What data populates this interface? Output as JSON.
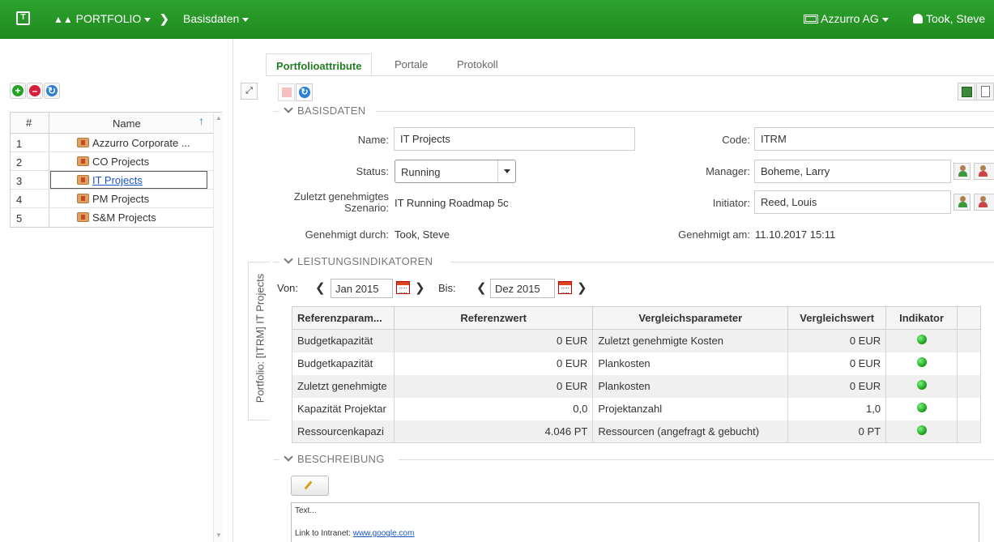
{
  "topbar": {
    "logo": "T",
    "portfolio_menu": "PORTFOLIO",
    "breadcrumb": "Basisdaten",
    "company": "Azzurro AG",
    "user": "Took, Steve"
  },
  "left": {
    "col_num": "#",
    "col_name": "Name",
    "rows": [
      {
        "num": "1",
        "name": "Azzurro Corporate ..."
      },
      {
        "num": "2",
        "name": "CO Projects"
      },
      {
        "num": "3",
        "name": "IT Projects"
      },
      {
        "num": "4",
        "name": "PM Projects"
      },
      {
        "num": "5",
        "name": "S&M Projects"
      }
    ]
  },
  "tabs": {
    "attr": "Portfolioattribute",
    "portale": "Portale",
    "protokoll": "Protokoll"
  },
  "vertical_tab": "Portfolio: [ITRM] IT Projects",
  "basisdaten": {
    "header": "BASISDATEN",
    "name_label": "Name:",
    "name_value": "IT Projects",
    "status_label": "Status:",
    "status_value": "Running",
    "scenario_label_1": "Zuletzt genehmigtes",
    "scenario_label_2": "Szenario:",
    "scenario_value": "IT Running Roadmap 5c",
    "approved_by_label": "Genehmigt durch:",
    "approved_by_value": "Took, Steve",
    "code_label": "Code:",
    "code_value": "ITRM",
    "manager_label": "Manager:",
    "manager_value": "Boheme, Larry",
    "initiator_label": "Initiator:",
    "initiator_value": "Reed, Louis",
    "approved_at_label": "Genehmigt am:",
    "approved_at_value": "11.10.2017 15:11"
  },
  "kpi": {
    "header": "LEISTUNGSINDIKATOREN",
    "von_label": "Von:",
    "von_value": "Jan 2015",
    "bis_label": "Bis:",
    "bis_value": "Dez 2015",
    "columns": [
      "Referenzparam...",
      "Referenzwert",
      "Vergleichsparameter",
      "Vergleichswert",
      "Indikator"
    ],
    "rows": [
      {
        "ref": "Budgetkapazität",
        "refval": "0 EUR",
        "cmp": "Zuletzt genehmigte Kosten",
        "cmpval": "0 EUR"
      },
      {
        "ref": "Budgetkapazität",
        "refval": "0 EUR",
        "cmp": "Plankosten",
        "cmpval": "0 EUR"
      },
      {
        "ref": "Zuletzt genehmigte",
        "refval": "0 EUR",
        "cmp": "Plankosten",
        "cmpval": "0 EUR"
      },
      {
        "ref": "Kapazität Projektar",
        "refval": "0,0",
        "cmp": "Projektanzahl",
        "cmpval": "1,0"
      },
      {
        "ref": "Ressourcenkapazi",
        "refval": "4.046 PT",
        "cmp": "Ressourcen (angefragt & gebucht)",
        "cmpval": "0 PT"
      }
    ],
    "indicator_color": "#22b022"
  },
  "beschreibung": {
    "header": "BESCHREIBUNG",
    "text": "Text...",
    "link_prefix": "Link to Intranet: ",
    "link_text": "www.google.com"
  }
}
